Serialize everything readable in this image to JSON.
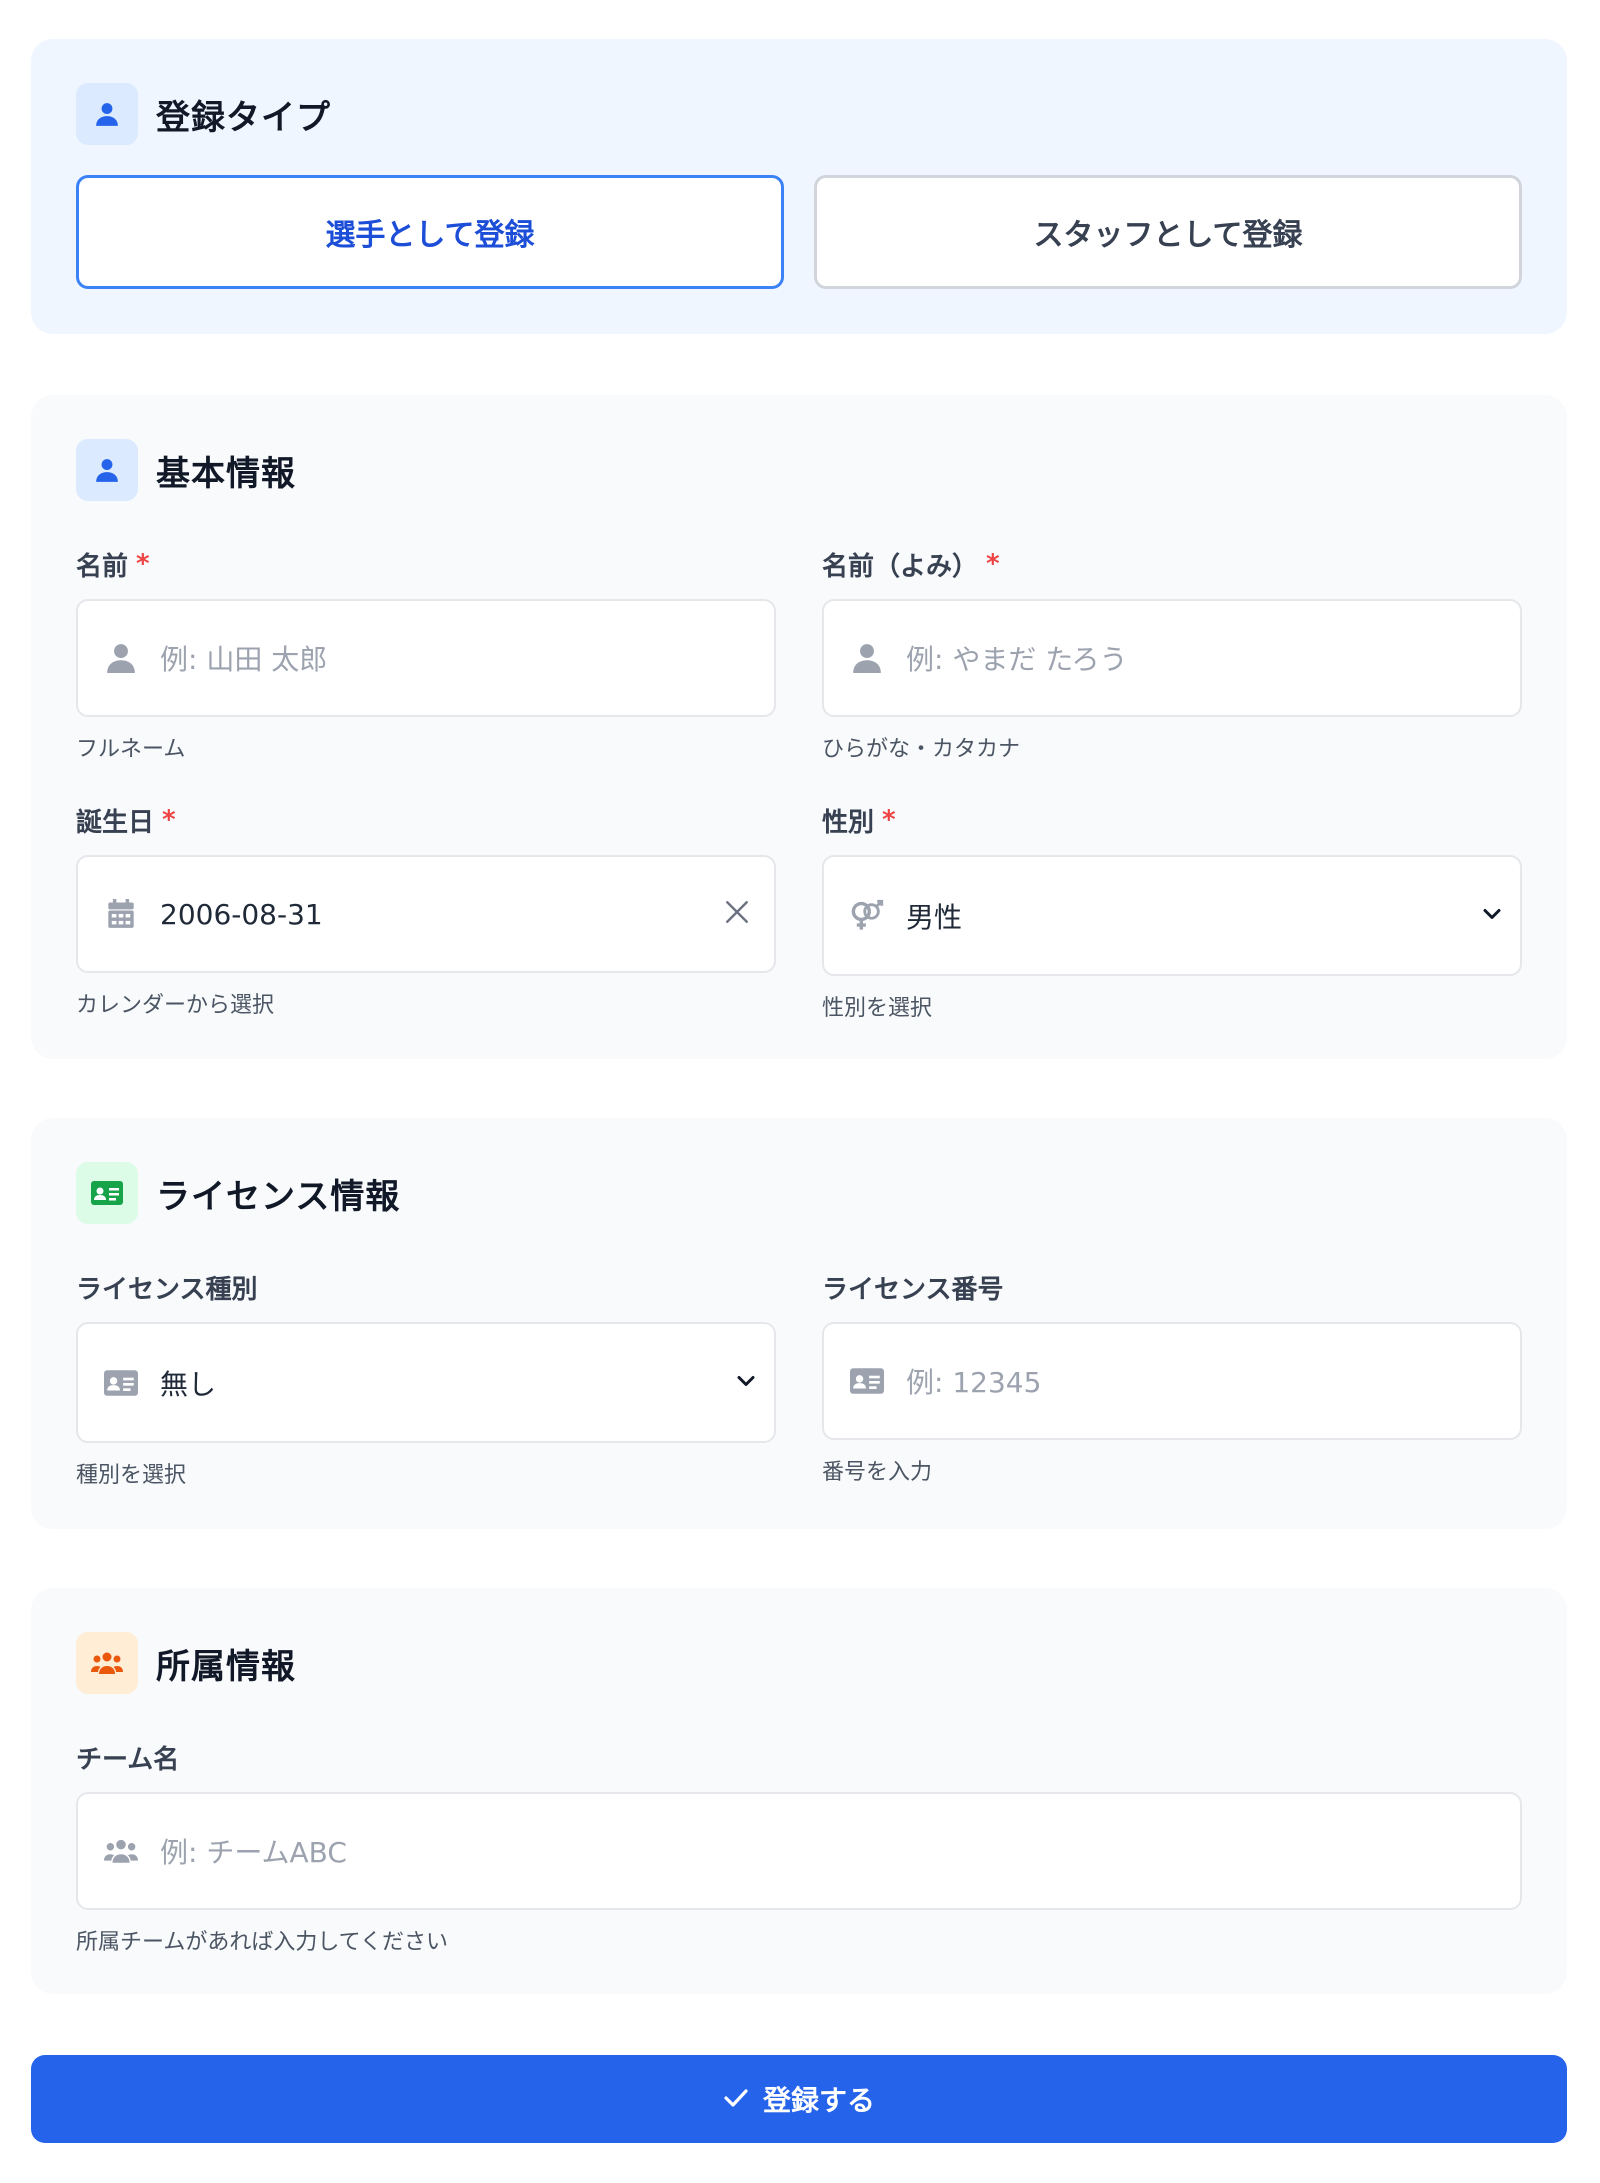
{
  "registration_type": {
    "title": "登録タイプ",
    "title_icon": "user-icon",
    "player_label": "選手として登録",
    "staff_label": "スタッフとして登録",
    "selected": "player",
    "accent_color": "#3b82f6"
  },
  "basic": {
    "title": "基本情報",
    "title_icon": "user-icon",
    "name": {
      "label": "名前",
      "required": "*",
      "placeholder": "例: 山田 太郎",
      "hint": "フルネーム",
      "icon": "user-icon"
    },
    "name_kana": {
      "label": "名前（よみ）",
      "required": "*",
      "placeholder": "例: やまだ たろう",
      "hint": "ひらがな・カタカナ",
      "icon": "user-icon"
    },
    "birthday": {
      "label": "誕生日",
      "required": "*",
      "value": "2006-08-31",
      "hint": "カレンダーから選択",
      "icon": "calendar-icon"
    },
    "gender": {
      "label": "性別",
      "required": "*",
      "value": "男性",
      "hint": "性別を選択",
      "icon": "gender-icon"
    }
  },
  "license": {
    "title": "ライセンス情報",
    "title_icon": "id-card-icon",
    "type": {
      "label": "ライセンス種別",
      "value": "無し",
      "hint": "種別を選択",
      "icon": "id-card-icon"
    },
    "number": {
      "label": "ライセンス番号",
      "placeholder": "例: 12345",
      "hint": "番号を入力",
      "icon": "id-card-icon"
    }
  },
  "team": {
    "title": "所属情報",
    "title_icon": "users-icon",
    "name": {
      "label": "チーム名",
      "placeholder": "例: チームABC",
      "hint": "所属チームがあれば入力してください",
      "icon": "users-icon"
    }
  },
  "submit": {
    "label": "登録する",
    "icon": "check-icon",
    "color": "#2563eb"
  }
}
